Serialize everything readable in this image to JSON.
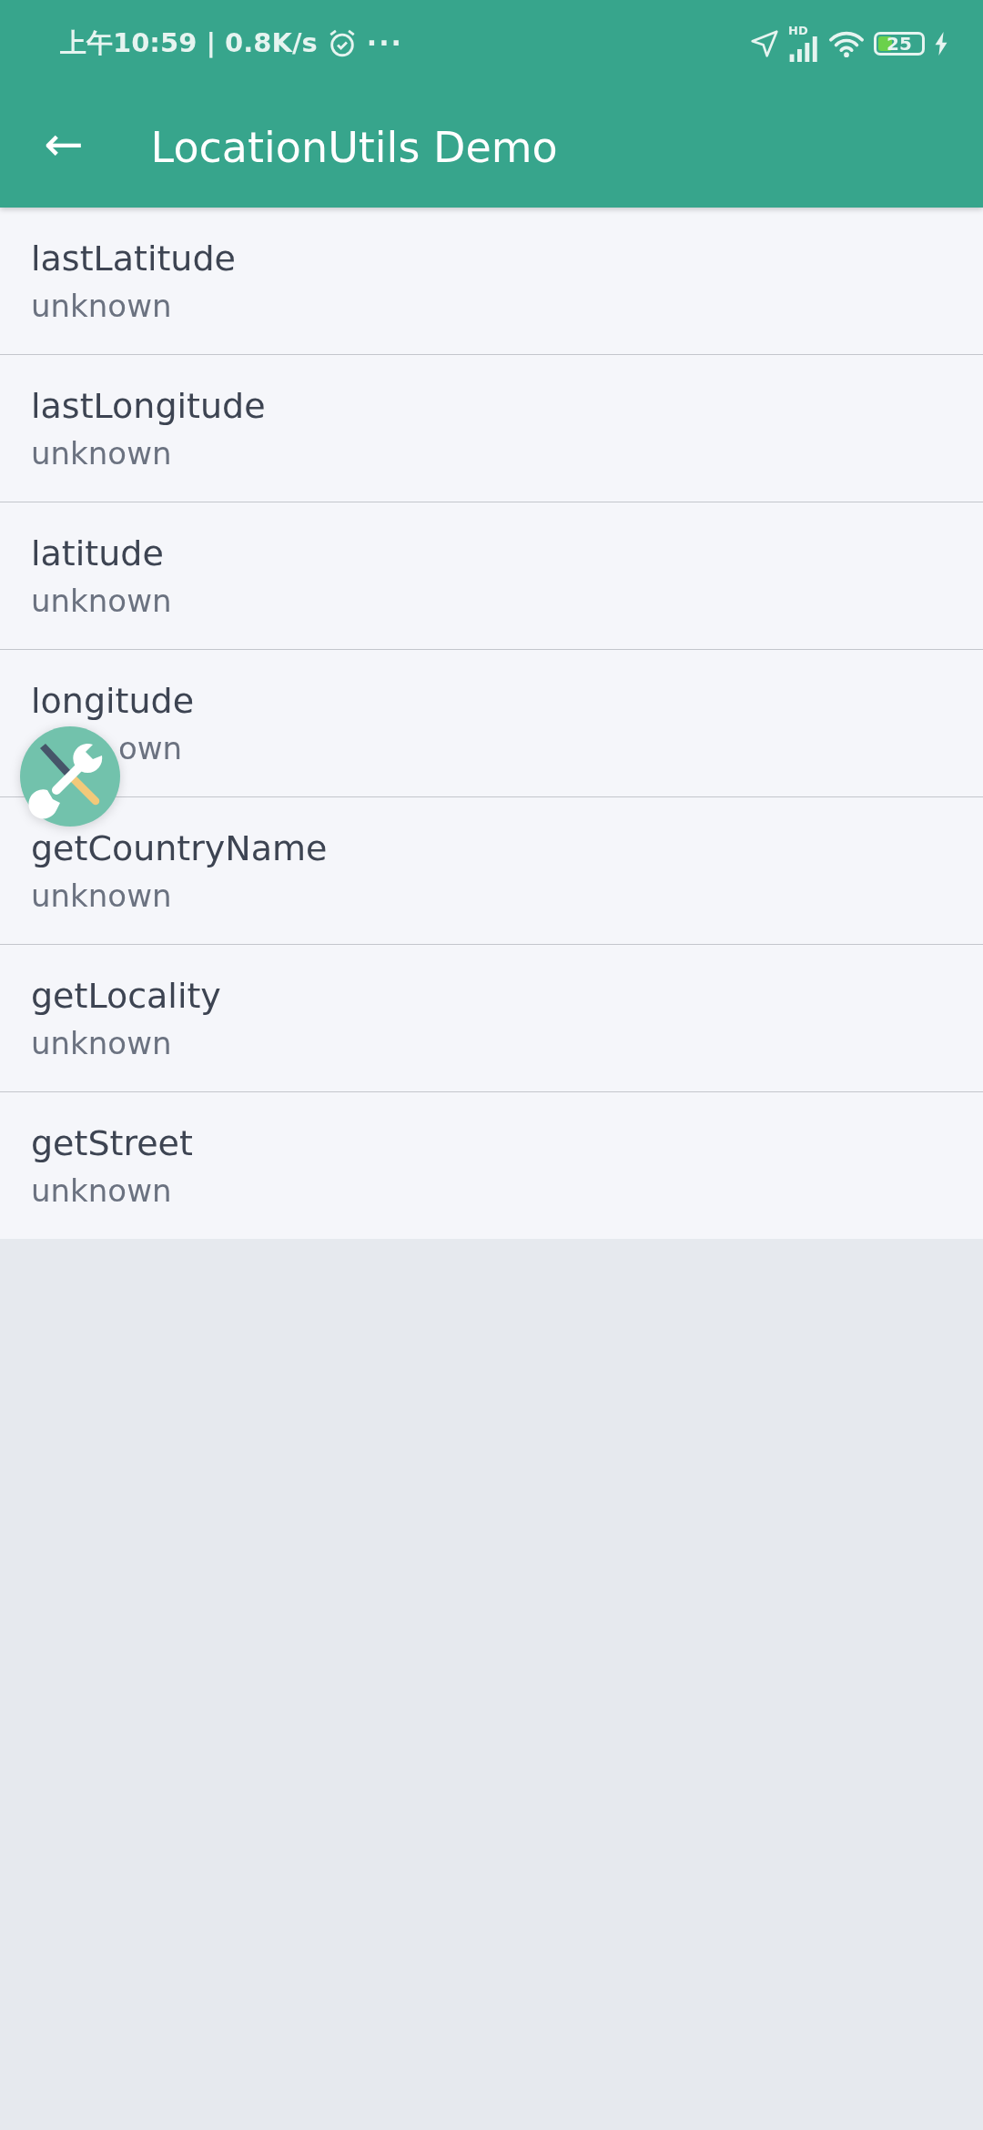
{
  "status_bar": {
    "time": "上午10:59 | 0.8K/s",
    "more": "···",
    "network": "HD",
    "battery": {
      "text": "25",
      "level": 0.3
    },
    "charging": true
  },
  "app_bar": {
    "back": "←",
    "title": "LocationUtils Demo"
  },
  "items": [
    {
      "name": "lastLatitude",
      "value": "unknown",
      "obscured": false
    },
    {
      "name": "lastLongitude",
      "value": "unknown",
      "obscured": false
    },
    {
      "name": "latitude",
      "value": "unknown",
      "obscured": false
    },
    {
      "name": "longitude",
      "value": "own",
      "obscured": true
    },
    {
      "name": "getCountryName",
      "value": "unknown",
      "obscured": false
    },
    {
      "name": "getLocality",
      "value": "unknown",
      "obscured": false
    },
    {
      "name": "getStreet",
      "value": "unknown",
      "obscured": false
    }
  ]
}
